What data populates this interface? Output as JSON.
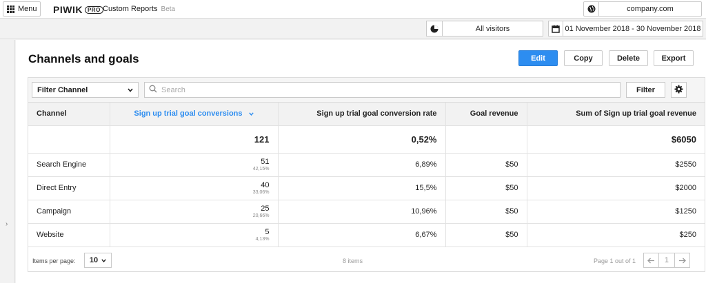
{
  "topbar": {
    "menu_label": "Menu",
    "logo_text": "PIWIK",
    "logo_badge": "PRO",
    "product_name": "Custom Reports",
    "product_badge": "Beta",
    "website": "company.com",
    "website_icon": "globe-icon"
  },
  "subbar": {
    "segment": "All visitors",
    "segment_icon": "pie-chart-icon",
    "date_range": "01 November 2018 - 30 November 2018",
    "date_icon": "calendar-icon"
  },
  "report": {
    "title": "Channels and goals",
    "actions": {
      "edit": "Edit",
      "copy": "Copy",
      "delete": "Delete",
      "export": "Export"
    },
    "accent_color": "#2d8df0"
  },
  "toolbar": {
    "filter_select": "Filter Channel",
    "search_placeholder": "Search",
    "filter_button": "Filter"
  },
  "table": {
    "columns": {
      "channel": "Channel",
      "conversions": "Sign up trial goal conversions",
      "rate": "Sign up trial goal conversion rate",
      "revenue": "Goal revenue",
      "sum_revenue": "Sum of Sign up trial goal revenue"
    },
    "totals": {
      "conversions": "121",
      "rate": "0,52%",
      "revenue": "",
      "sum_revenue": "$6050"
    },
    "rows": [
      {
        "channel": "Search Engine",
        "conversions": "51",
        "share": "42,15%",
        "rate": "6,89%",
        "revenue": "$50",
        "sum_revenue": "$2550"
      },
      {
        "channel": "Direct Entry",
        "conversions": "40",
        "share": "33,06%",
        "rate": "15,5%",
        "revenue": "$50",
        "sum_revenue": "$2000"
      },
      {
        "channel": "Campaign",
        "conversions": "25",
        "share": "20,66%",
        "rate": "10,96%",
        "revenue": "$50",
        "sum_revenue": "$1250"
      },
      {
        "channel": "Website",
        "conversions": "5",
        "share": "4,13%",
        "rate": "6,67%",
        "revenue": "$50",
        "sum_revenue": "$250"
      }
    ]
  },
  "footer": {
    "items_per_page_label": "Items per page:",
    "items_per_page": "10",
    "items_count": "8 items",
    "page_info": "Page 1 out of 1",
    "current_page": "1"
  }
}
